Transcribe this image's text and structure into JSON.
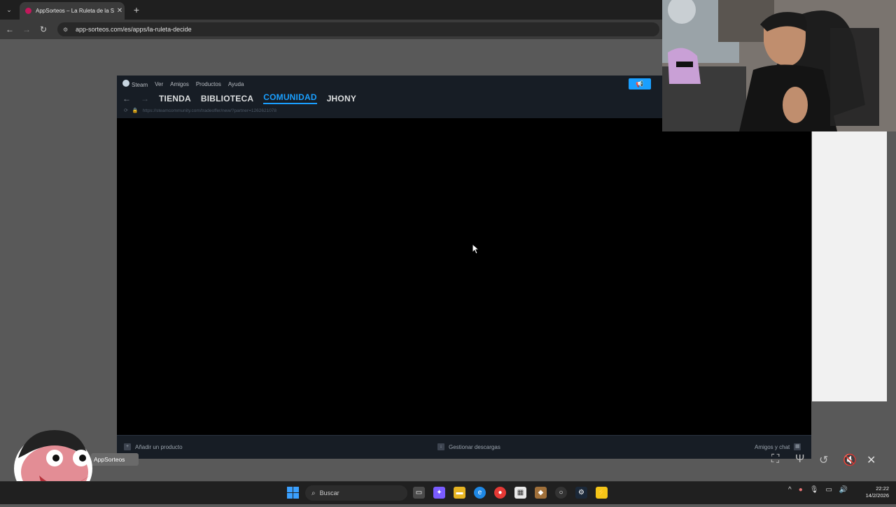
{
  "browser": {
    "tab_title": "AppSorteos – La Ruleta de la S",
    "url": "app-sorteos.com/es/apps/la-ruleta-decide"
  },
  "steam": {
    "menu": [
      "Steam",
      "Ver",
      "Amigos",
      "Productos",
      "Ayuda"
    ],
    "nav": {
      "tienda": "TIENDA",
      "biblioteca": "BIBLIOTECA",
      "comunidad": "COMUNIDAD",
      "user": "JHONY",
      "active": "COMUNIDAD"
    },
    "url": "https://steamcommunity.com/tradeoffer/new/?partner=1262621078",
    "footer": {
      "add_product": "Añadir un producto",
      "downloads": "Gestionar descargas",
      "friends": "Amigos y chat"
    },
    "accent_color": "#1a9fff"
  },
  "overlay": {
    "appsorteos_label": "AppSorteos"
  },
  "taskbar": {
    "search_placeholder": "Buscar",
    "time": "22:22",
    "date": "14/2/2026"
  }
}
